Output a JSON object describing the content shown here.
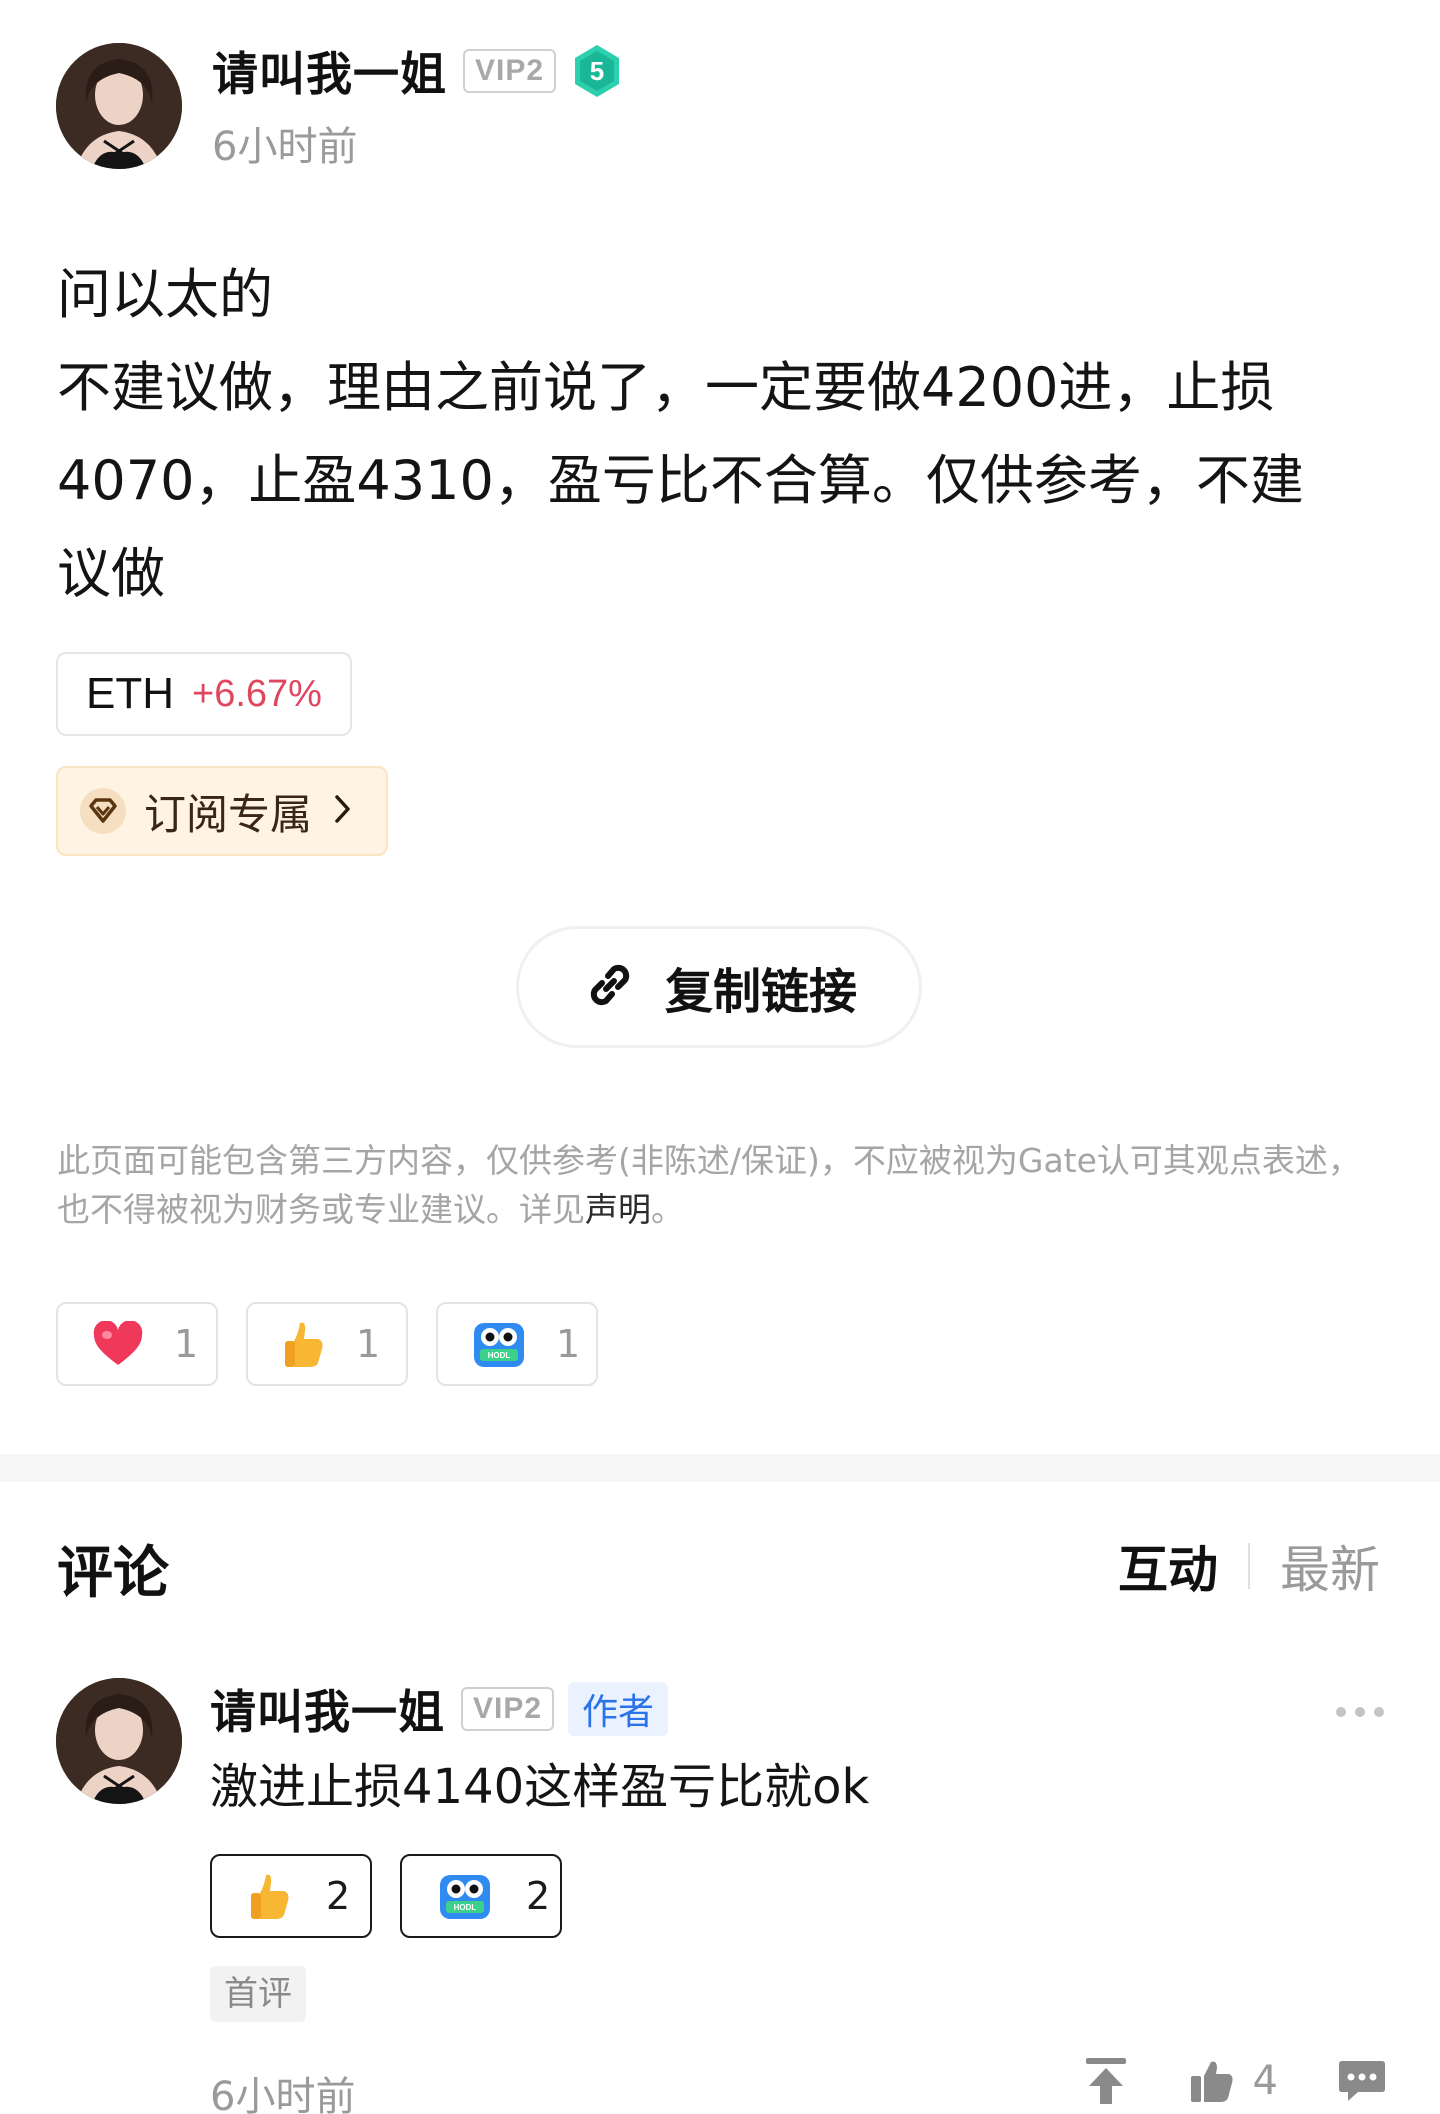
{
  "post": {
    "author_name": "请叫我一姐",
    "vip_label": "VIP2",
    "level": "5",
    "time": "6小时前",
    "body_lines": [
      "问以太的",
      "不建议做，理由之前说了，一定要做4200进，止损",
      "4070，止盈4310，盈亏比不合算。仅供参考，不建",
      "议做"
    ],
    "coin": {
      "symbol": "ETH",
      "change": "+6.67%"
    },
    "subscribe_label": "订阅专属",
    "copy_link_label": "复制链接",
    "disclaimer_text": "此页面可能包含第三方内容，仅供参考(非陈述/保证)，不应被视为Gate认可其观点表述，也不得被视为财务或专业建议。详见",
    "disclaimer_link": "声明",
    "disclaimer_end": "。",
    "reactions": [
      {
        "icon": "heart-icon",
        "count": "1"
      },
      {
        "icon": "thumbs-up-icon",
        "count": "1"
      },
      {
        "icon": "hodl-owl-icon",
        "count": "1"
      }
    ]
  },
  "comments_section": {
    "title": "评论",
    "sort_tabs": [
      {
        "label": "互动",
        "active": true
      },
      {
        "label": "最新",
        "active": false
      }
    ],
    "comments": [
      {
        "author_name": "请叫我一姐",
        "vip_label": "VIP2",
        "author_tag": "作者",
        "text": "激进止损4140这样盈亏比就ok",
        "reactions": [
          {
            "icon": "thumbs-up-icon",
            "count": "2"
          },
          {
            "icon": "hodl-owl-icon",
            "count": "2"
          }
        ],
        "first_tag": "首评",
        "time": "6小时前",
        "like_count": "4"
      }
    ]
  },
  "colors": {
    "positive_change": "#e0475f",
    "author_tag_text": "#2a73e8",
    "author_tag_bg": "#eaf2ff",
    "subscribe_bg": "#fff3e3",
    "level_badge": "#2ccfae"
  }
}
